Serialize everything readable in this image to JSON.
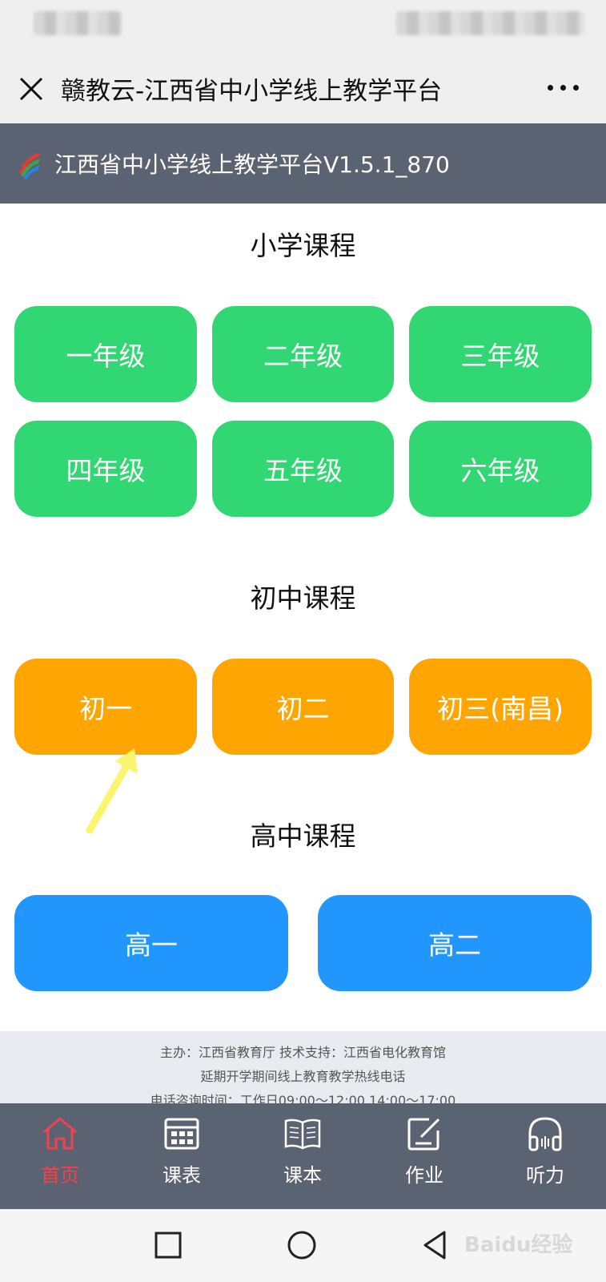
{
  "titlebar": {
    "title": "赣教云-江西省中小学线上教学平台"
  },
  "app_header": {
    "title": "江西省中小学线上教学平台V1.5.1_870"
  },
  "primary": {
    "title": "小学课程",
    "grades": [
      "一年级",
      "二年级",
      "三年级",
      "四年级",
      "五年级",
      "六年级"
    ]
  },
  "junior": {
    "title": "初中课程",
    "grades": [
      "初一",
      "初二",
      "初三(南昌)"
    ]
  },
  "senior": {
    "title": "高中课程",
    "grades": [
      "高一",
      "高二"
    ]
  },
  "footer": {
    "line1": "主办：江西省教育厅 技术支持：江西省电化教育馆",
    "line2": "延期开学期间线上教育教学热线电话",
    "line3": "电话咨询时间：工作日09:00～12:00 14:00～17:00"
  },
  "tabs": [
    {
      "label": "首页",
      "icon": "home-icon",
      "active": true
    },
    {
      "label": "课表",
      "icon": "calendar-icon",
      "active": false
    },
    {
      "label": "课本",
      "icon": "book-icon",
      "active": false
    },
    {
      "label": "作业",
      "icon": "edit-icon",
      "active": false
    },
    {
      "label": "听力",
      "icon": "headphones-icon",
      "active": false
    }
  ],
  "colors": {
    "primary_button": "#30d772",
    "junior_button": "#ffa502",
    "senior_button": "#2196fc",
    "header_bg": "#5b6271",
    "active_tab": "#f2424f"
  },
  "watermark": "Baidu经验"
}
